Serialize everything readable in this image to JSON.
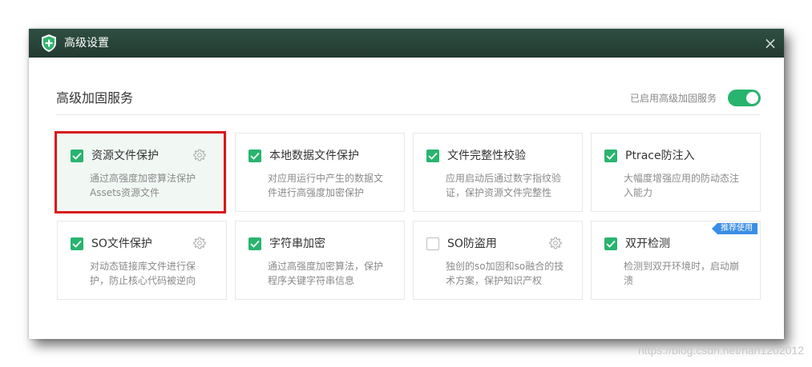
{
  "window": {
    "title": "高级设置",
    "close_symbol": "×",
    "icon": "shield-plus-icon"
  },
  "section": {
    "title": "高级加固服务",
    "status_label": "已启用高级加固服务",
    "toggle_on": true,
    "accent_color": "#28b46e"
  },
  "cards": [
    {
      "name": "资源文件保护",
      "desc_lines": [
        "通过高强度加密算法保护",
        "Assets资源文件"
      ],
      "checked": true,
      "has_gear": true,
      "active": true
    },
    {
      "name": "本地数据文件保护",
      "desc_lines": [
        "对应用运行中产生的数据文",
        "件进行高强度加密保护"
      ],
      "checked": true,
      "has_gear": false,
      "active": false
    },
    {
      "name": "文件完整性校验",
      "desc_lines": [
        "应用启动后通过数字指纹验",
        "证，保护资源文件完整性"
      ],
      "checked": true,
      "has_gear": false,
      "active": false
    },
    {
      "name": "Ptrace防注入",
      "desc_lines": [
        "大幅度增强应用的防动态注",
        "入能力"
      ],
      "checked": true,
      "has_gear": false,
      "active": false
    },
    {
      "name": "SO文件保护",
      "desc_lines": [
        "对动态链接库文件进行保",
        "护，防止核心代码被逆向"
      ],
      "checked": true,
      "has_gear": true,
      "active": false
    },
    {
      "name": "字符串加密",
      "desc_lines": [
        "通过高强度加密算法，保护",
        "程序关键字符串信息"
      ],
      "checked": true,
      "has_gear": false,
      "active": false
    },
    {
      "name": "SO防盗用",
      "desc_lines": [
        "独创的so加固和so融合的技",
        "术方案，保护知识产权"
      ],
      "checked": false,
      "has_gear": true,
      "active": false
    },
    {
      "name": "双开检测",
      "desc_lines": [
        "检测到双开环境时，启动崩",
        "溃"
      ],
      "checked": true,
      "has_gear": false,
      "active": false,
      "badge": "推荐使用"
    }
  ],
  "watermark": "https://blog.csdn.net/han1202012"
}
